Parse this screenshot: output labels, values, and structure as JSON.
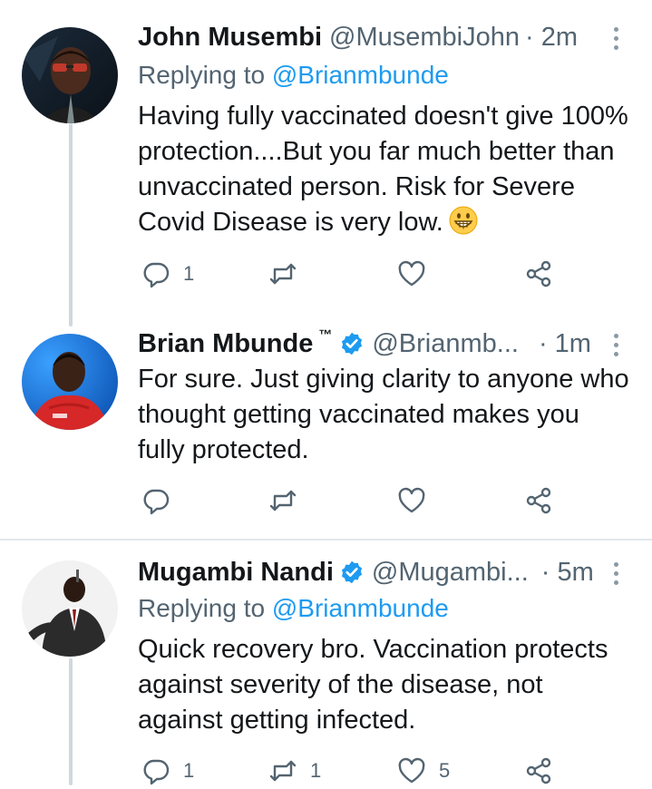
{
  "colors": {
    "link": "#1d9bf0",
    "secondary": "#536471",
    "verified": "#1d9bf0",
    "thread_line": "#cfd9de"
  },
  "tweets": [
    {
      "name": "John Musembi",
      "handle": "@MusembiJohn",
      "time": "· 2m",
      "replying_prefix": "Replying to ",
      "replying_to": "@Brianmbunde",
      "text": "Having fully vaccinated doesn't give 100% protection....But you far much better than unvaccinated person. Risk for Severe Covid Disease is very low.",
      "emoji": "grinning-face-emoji",
      "reply_count": "1",
      "retweet_count": "",
      "like_count": ""
    },
    {
      "name": "Brian Mbunde",
      "tm": "™",
      "verified": true,
      "handle": "@Brianmb...",
      "time": "· 1m",
      "text": "For sure. Just giving clarity to anyone who thought getting vaccinated makes you fully protected.",
      "reply_count": "",
      "retweet_count": "",
      "like_count": ""
    },
    {
      "name": "Mugambi Nandi",
      "verified": true,
      "handle": "@Mugambi...",
      "time": "· 5m",
      "replying_prefix": "Replying to ",
      "replying_to": "@Brianmbunde",
      "text": "Quick recovery bro. Vaccination protects against severity of the disease, not against getting infected.",
      "reply_count": "1",
      "retweet_count": "1",
      "like_count": "5"
    }
  ],
  "icons": [
    "reply-icon",
    "retweet-icon",
    "like-icon",
    "share-icon",
    "more-options-icon",
    "verified-badge-icon"
  ]
}
